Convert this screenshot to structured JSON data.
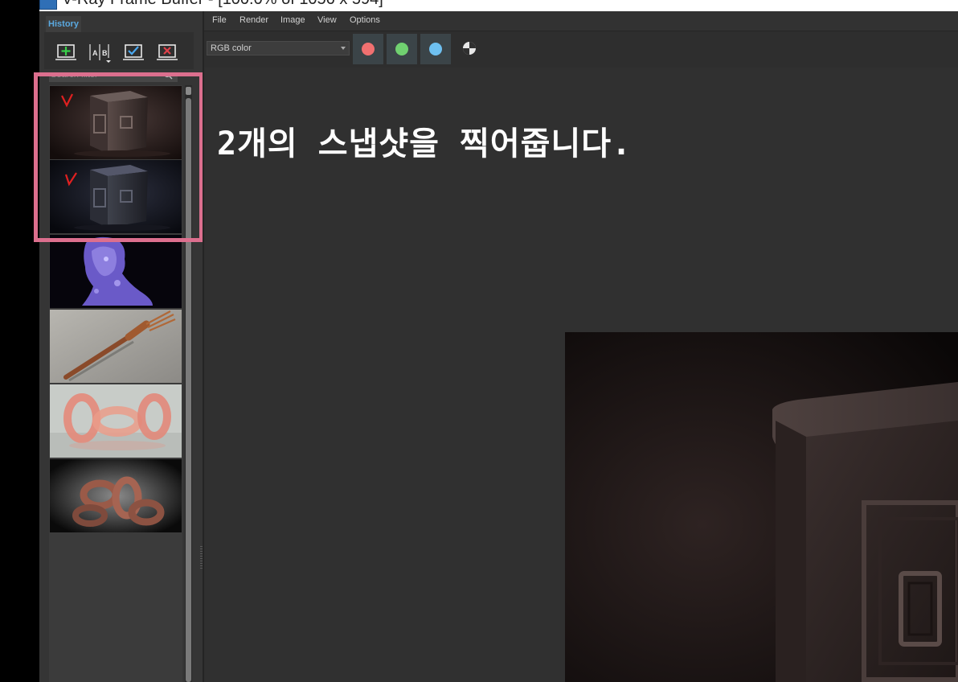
{
  "window": {
    "title": "V-Ray Frame Buffer - [100.0% of 1056 x 594]"
  },
  "history": {
    "tab_label": "History",
    "buttons": [
      {
        "name": "save-to-history",
        "icon": "add-plus-icon"
      },
      {
        "name": "ab-compare",
        "icon": "ab-compare-icon",
        "label": "A|B"
      },
      {
        "name": "load-from-history",
        "icon": "check-icon"
      },
      {
        "name": "remove-from-history",
        "icon": "close-x-icon"
      }
    ],
    "search_placeholder": "Search filter",
    "thumbnails": [
      {
        "subject": "cube-warm",
        "marked": true,
        "mark": "V"
      },
      {
        "subject": "cube-cool",
        "marked": true,
        "mark": "V"
      },
      {
        "subject": "crystal-head",
        "marked": false
      },
      {
        "subject": "fork",
        "marked": false
      },
      {
        "subject": "glass-chain-pink",
        "marked": false
      },
      {
        "subject": "glass-chain-dark",
        "marked": false
      }
    ],
    "highlight_color": "#dc6f8e"
  },
  "menu": [
    "File",
    "Render",
    "Image",
    "View",
    "Options"
  ],
  "toolbar": {
    "channel_value": "RGB color",
    "channels": [
      {
        "name": "red-channel",
        "color": "#f07070"
      },
      {
        "name": "green-channel",
        "color": "#70d070"
      },
      {
        "name": "blue-channel",
        "color": "#6ec0f0"
      }
    ]
  },
  "annotation": {
    "text": "2개의 스냅샷을 찍어줍니다."
  }
}
